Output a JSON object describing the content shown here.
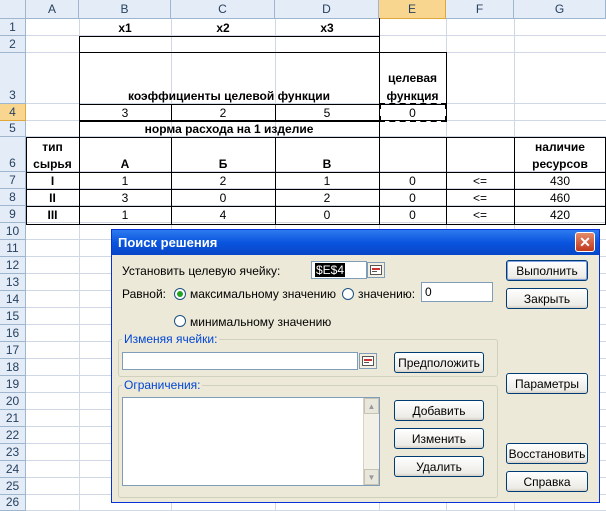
{
  "columns": [
    "A",
    "B",
    "C",
    "D",
    "E",
    "F",
    "G"
  ],
  "rows": [
    "1",
    "2",
    "3",
    "4",
    "5",
    "6",
    "7",
    "8",
    "9",
    "10",
    "11",
    "12",
    "13",
    "14",
    "15",
    "16",
    "17",
    "18",
    "19",
    "20",
    "21",
    "22",
    "23",
    "24",
    "25",
    "26"
  ],
  "cells": {
    "b1": "x1",
    "c1": "x2",
    "d1": "x3",
    "b3": "коэффициенты целевой функции",
    "e3a": "целевая",
    "e3b": "функция",
    "b4": "3",
    "c4": "2",
    "d4": "5",
    "e4": "0",
    "b5": "норма расхода на 1 изделие",
    "a6a": "тип",
    "a6b": "сырья",
    "b6": "А",
    "c6": "Б",
    "d6": "В",
    "g6a": "наличие",
    "g6b": "ресурсов",
    "r7": [
      "I",
      "1",
      "2",
      "1",
      "0",
      "<=",
      "430"
    ],
    "r8": [
      "II",
      "3",
      "0",
      "2",
      "0",
      "<=",
      "460"
    ],
    "r9": [
      "III",
      "1",
      "4",
      "0",
      "0",
      "<=",
      "420"
    ]
  },
  "dialog": {
    "title": "Поиск решения",
    "target_label": "Установить целевую ячейку:",
    "target_value": "$E$4",
    "equal_label": "Равной:",
    "opt_max": "максимальному значению",
    "opt_value": "значению:",
    "value_input": "0",
    "opt_min": "минимальному значению",
    "changing_label": "Изменяя ячейки:",
    "changing_value": "",
    "constraints_label": "Ограничения:",
    "btn_guess": "Предположить",
    "btn_add": "Добавить",
    "btn_change": "Изменить",
    "btn_delete": "Удалить",
    "btn_solve": "Выполнить",
    "btn_close": "Закрыть",
    "btn_options": "Параметры",
    "btn_reset": "Восстановить",
    "btn_help": "Справка",
    "close_glyph": "✕"
  }
}
